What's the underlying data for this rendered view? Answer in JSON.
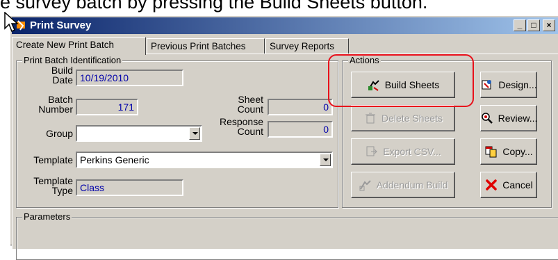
{
  "caption": "e survey batch by pressing the Build Sheets button.",
  "window": {
    "title": "Print Survey",
    "controls": [
      "_",
      "□",
      "×"
    ]
  },
  "tabs": [
    {
      "label": "Create New Print Batch",
      "active": true
    },
    {
      "label": "Previous Print Batches",
      "active": false
    },
    {
      "label": "Survey Reports",
      "active": false
    }
  ],
  "identification": {
    "legend": "Print Batch Identification",
    "build_date_label": "Build Date",
    "build_date": "10/19/2010",
    "batch_number_label": "Batch Number",
    "batch_number": "171",
    "sheet_count_label": "Sheet Count",
    "sheet_count": "0",
    "response_count_label": "Response Count",
    "response_count": "0",
    "group_label": "Group",
    "group_value": "",
    "template_label": "Template",
    "template_value": "Perkins Generic",
    "template_type_label": "Template Type",
    "template_type": "Class"
  },
  "actions": {
    "legend": "Actions",
    "build_sheets": "Build Sheets",
    "design": "Design...",
    "delete_sheets": "Delete Sheets",
    "review": "Review...",
    "export_csv": "Export CSV...",
    "copy": "Copy...",
    "addendum_build": "Addendum Build",
    "cancel": "Cancel"
  },
  "parameters": {
    "legend": "Parameters"
  },
  "colors": {
    "highlight": "#e8101a",
    "title_bar": "#0a246a",
    "field_text": "#0000aa"
  }
}
